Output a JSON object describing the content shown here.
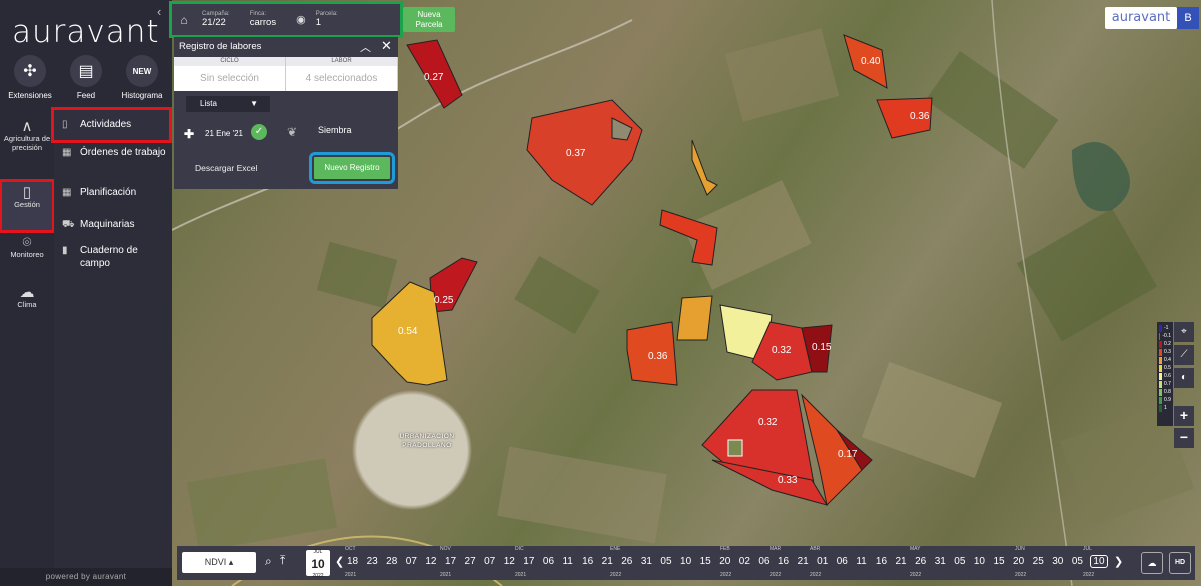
{
  "brand": {
    "logo": "auravant",
    "powered": "powered by auravant",
    "top_right": "auravant",
    "user_initial": "B"
  },
  "rail_top": [
    {
      "label": "Extensiones",
      "icon": "puzzle-icon"
    },
    {
      "label": "Feed",
      "icon": "feed-icon"
    },
    {
      "label": "Histograma",
      "icon_text": "NEW"
    }
  ],
  "rail": {
    "agricultura": "Agricultura de precisión",
    "gestion": "Gestión",
    "monitoreo": "Monitoreo",
    "clima": "Clima"
  },
  "submenu": [
    {
      "label": "Actividades"
    },
    {
      "label": "Órdenes de trabajo"
    },
    {
      "label": "Planificación"
    },
    {
      "label": "Maquinarias"
    },
    {
      "label": "Cuaderno de campo"
    }
  ],
  "topbar": {
    "campana_label": "Campaña:",
    "campana_value": "21/22",
    "finca_label": "Finca:",
    "finca_value": "carros",
    "parcela_label": "Parcela:",
    "parcela_value": "1",
    "nueva_parcela": "Nueva Parcela"
  },
  "panel": {
    "title": "Registro de labores",
    "col1_header": "CICLO",
    "col1_value": "Sin selección",
    "col2_header": "LABOR",
    "col2_value": "4 seleccionados",
    "view": "Lista",
    "record_date": "21 Ene '21",
    "record_labor": "Siembra",
    "download": "Descargar Excel",
    "new_record": "Nuevo Registro"
  },
  "map_labels": {
    "place": "URBANIZACION PRADOLLANO",
    "values": [
      "0.27",
      "0.40",
      "0.36",
      "0.37",
      "0.25",
      "0.54",
      "0.36",
      "0.32",
      "0.15",
      "0.32",
      "0.17",
      "0.33"
    ]
  },
  "legend": [
    {
      "label": "-1",
      "color": "#2b2bb0"
    },
    {
      "label": "-0.1",
      "color": "#6060d0"
    },
    {
      "label": "0.2",
      "color": "#b51a1a"
    },
    {
      "label": "0.3",
      "color": "#e04a20"
    },
    {
      "label": "0.4",
      "color": "#f0a030"
    },
    {
      "label": "0.5",
      "color": "#f5d040"
    },
    {
      "label": "0.6",
      "color": "#f2f09a"
    },
    {
      "label": "0.7",
      "color": "#c8e070"
    },
    {
      "label": "0.8",
      "color": "#7fc850"
    },
    {
      "label": "0.9",
      "color": "#3aa040"
    },
    {
      "label": "1",
      "color": "#1a6a2a"
    }
  ],
  "timeline": {
    "index": "NDVI",
    "cal_day": "10",
    "cal_month": "JUL",
    "cal_year": "2022",
    "days": [
      "18",
      "23",
      "28",
      "07",
      "12",
      "17",
      "27",
      "07",
      "12",
      "17",
      "06",
      "11",
      "16",
      "21",
      "26",
      "31",
      "05",
      "10",
      "15",
      "20",
      "02",
      "06",
      "16",
      "21",
      "01",
      "06",
      "11",
      "16",
      "21",
      "26",
      "31",
      "05",
      "10",
      "15",
      "20",
      "25",
      "30",
      "05",
      "10"
    ],
    "months": [
      "OCT",
      "NOV",
      "DIC",
      "ENE",
      "FEB",
      "MAR",
      "ABR",
      "MAY",
      "JUN",
      "JUL"
    ],
    "years": [
      "2021",
      "2021",
      "2021",
      "2022",
      "2022",
      "2022",
      "2022",
      "2022",
      "2022",
      "2022"
    ],
    "hd": "HD"
  }
}
